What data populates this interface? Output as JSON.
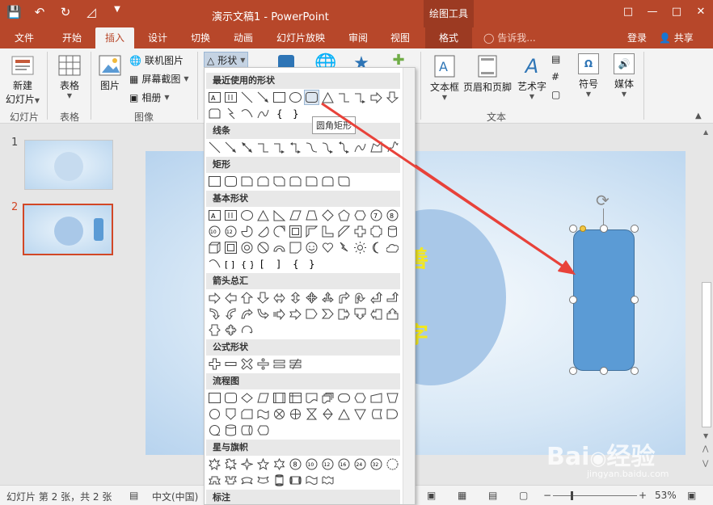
{
  "titlebar": {
    "document_title": "演示文稿1 - PowerPoint",
    "context_tab_title": "绘图工具",
    "qat": {
      "save_icon": "save-icon",
      "undo_icon": "undo-icon",
      "redo_icon": "redo-icon",
      "customize_icon": "customize-icon"
    }
  },
  "tabs": [
    {
      "label": "文件"
    },
    {
      "label": "开始"
    },
    {
      "label": "插入"
    },
    {
      "label": "设计"
    },
    {
      "label": "切换"
    },
    {
      "label": "动画"
    },
    {
      "label": "幻灯片放映"
    },
    {
      "label": "审阅"
    },
    {
      "label": "视图"
    },
    {
      "label": "格式"
    }
  ],
  "tellme": "告诉我...",
  "login": "登录",
  "share": "共享",
  "ribbon": {
    "new_slide": "新建\n幻灯片",
    "new_slide_line1": "新建",
    "new_slide_line2": "幻灯片",
    "table": "表格",
    "picture": "图片",
    "online_picture": "联机图片",
    "screenshot": "屏幕截图",
    "album": "相册",
    "shapes": "形状",
    "textbox": "文本框",
    "header_footer": "页眉和页脚",
    "wordart": "艺术字",
    "symbol": "符号",
    "media": "媒体",
    "group_slides": "幻灯片",
    "group_table": "表格",
    "group_image": "图像",
    "group_text": "文本"
  },
  "thumbs": [
    {
      "num": "1"
    },
    {
      "num": "2"
    }
  ],
  "slide": {
    "char1": "善",
    "char2": "字"
  },
  "status": {
    "slide_info": "幻灯片 第 2 张，共 2 张",
    "language": "中文(中国)",
    "zoom": "53%"
  },
  "dropdown": {
    "cat_recent": "最近使用的形状",
    "cat_lines": "线条",
    "cat_rect": "矩形",
    "cat_basic": "基本形状",
    "cat_arrows": "箭头总汇",
    "cat_equation": "公式形状",
    "cat_flowchart": "流程图",
    "cat_stars": "星与旗帜",
    "cat_callouts": "标注",
    "tooltip": "圆角矩形"
  },
  "colors": {
    "accent": "#b7472a",
    "shape_fill": "#5b9bd5",
    "arrow": "#e8423a",
    "text_yellow": "#f3e820"
  }
}
